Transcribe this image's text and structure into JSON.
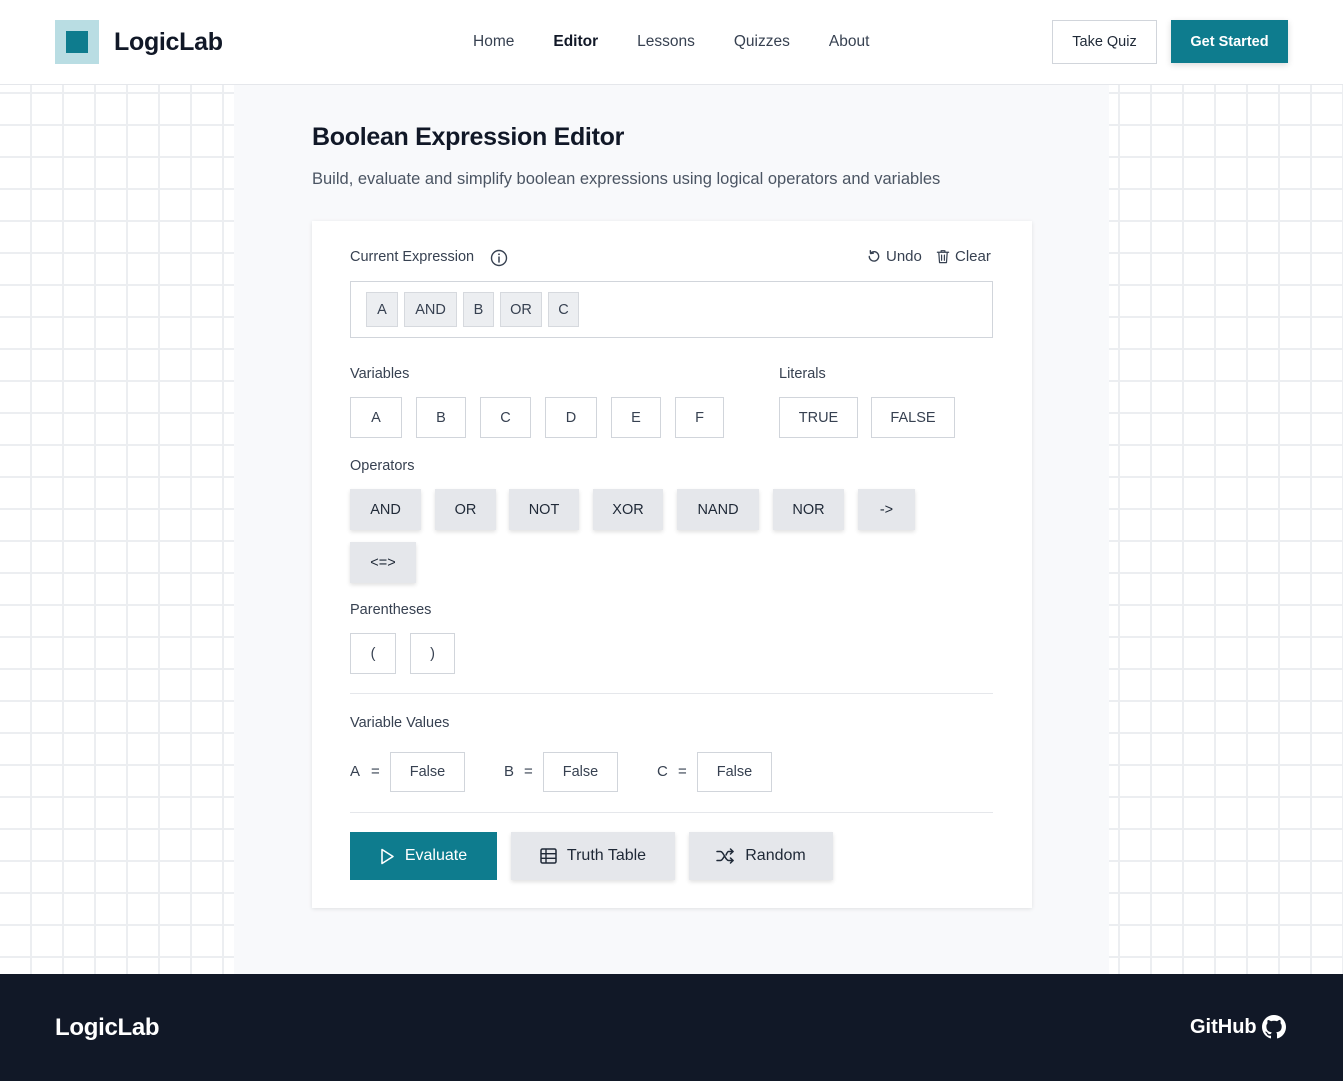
{
  "brand": {
    "name": "LogicLab"
  },
  "nav": {
    "items": [
      {
        "label": "Home",
        "active": false
      },
      {
        "label": "Editor",
        "active": true
      },
      {
        "label": "Lessons",
        "active": false
      },
      {
        "label": "Quizzes",
        "active": false
      },
      {
        "label": "About",
        "active": false
      }
    ],
    "take_quiz": "Take Quiz",
    "get_started": "Get Started"
  },
  "page": {
    "title": "Boolean Expression Editor",
    "subtitle": "Build, evaluate and simplify boolean expressions using logical operators and variables"
  },
  "editor": {
    "current_expression_label": "Current Expression",
    "undo": "Undo",
    "clear": "Clear",
    "tokens": [
      "A",
      "AND",
      "B",
      "OR",
      "C"
    ],
    "variables_label": "Variables",
    "variables": [
      "A",
      "B",
      "C",
      "D",
      "E",
      "F"
    ],
    "literals_label": "Literals",
    "literals": [
      "TRUE",
      "FALSE"
    ],
    "operators_label": "Operators",
    "operators": [
      "AND",
      "OR",
      "NOT",
      "XOR",
      "NAND",
      "NOR",
      "->",
      "<=>"
    ],
    "parentheses_label": "Parentheses",
    "parentheses": [
      "(",
      ")"
    ],
    "variable_values_label": "Variable Values",
    "variable_values": [
      {
        "name": "A",
        "eq": "=",
        "value": "False"
      },
      {
        "name": "B",
        "eq": "=",
        "value": "False"
      },
      {
        "name": "C",
        "eq": "=",
        "value": "False"
      }
    ],
    "actions": {
      "evaluate": "Evaluate",
      "truth_table": "Truth Table",
      "random": "Random"
    }
  },
  "footer": {
    "brand": "LogicLab",
    "github": "GitHub"
  },
  "colors": {
    "accent": "#0e7c8e",
    "footer_bg": "#111827"
  }
}
